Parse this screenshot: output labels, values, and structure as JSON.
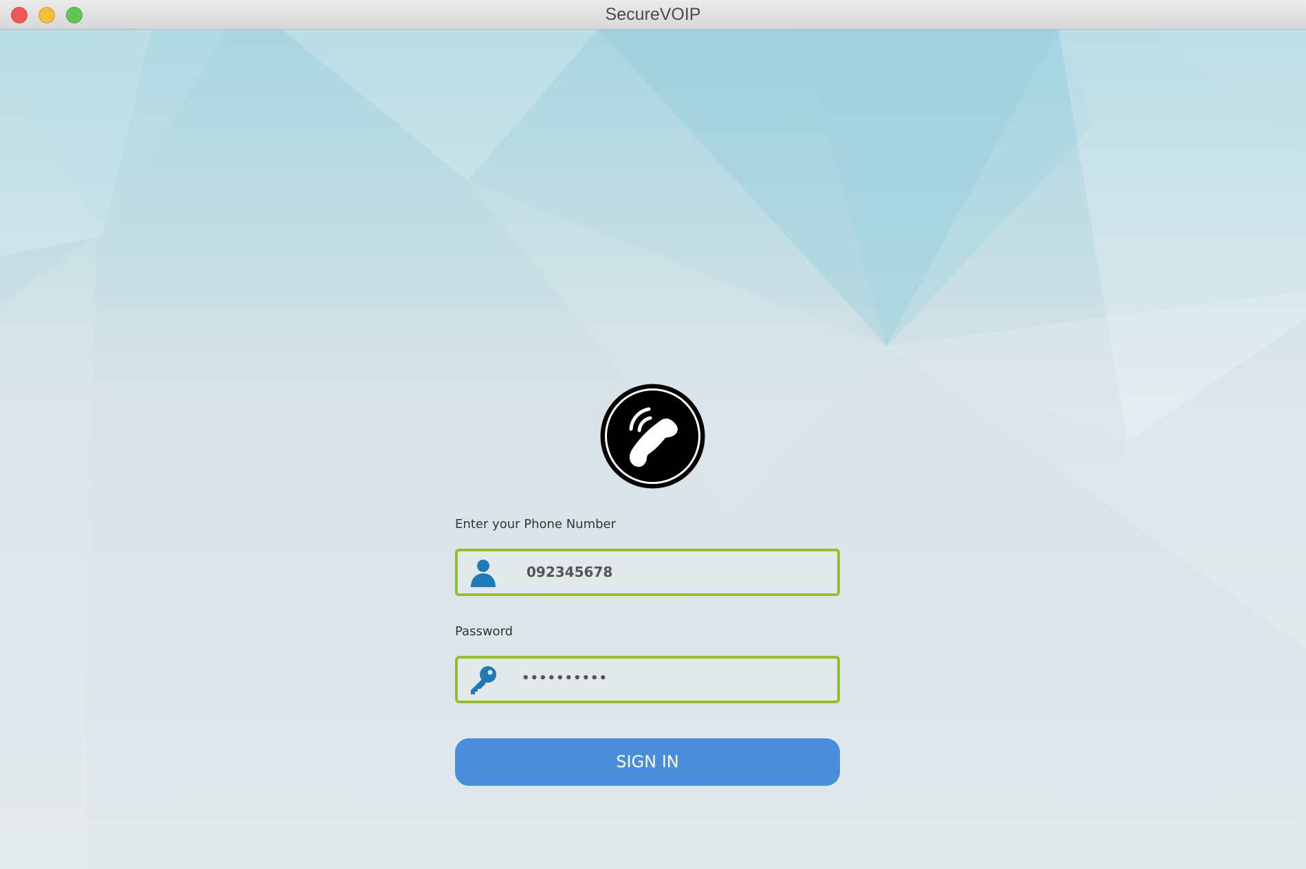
{
  "window": {
    "title": "SecureVOIP"
  },
  "login": {
    "phone_label": "Enter your Phone Number",
    "phone_value": "092345678",
    "phone_icon": "user-icon",
    "password_label": "Password",
    "password_value": "••••••••••",
    "password_icon": "key-icon",
    "sign_in_label": "SIGN IN",
    "logo_icon": "phone-call-icon"
  },
  "colors": {
    "field_border": "#95be2b",
    "button": "#4a8ddb",
    "icon_blue": "#1f7ab8",
    "background": "#e3e8eb"
  }
}
